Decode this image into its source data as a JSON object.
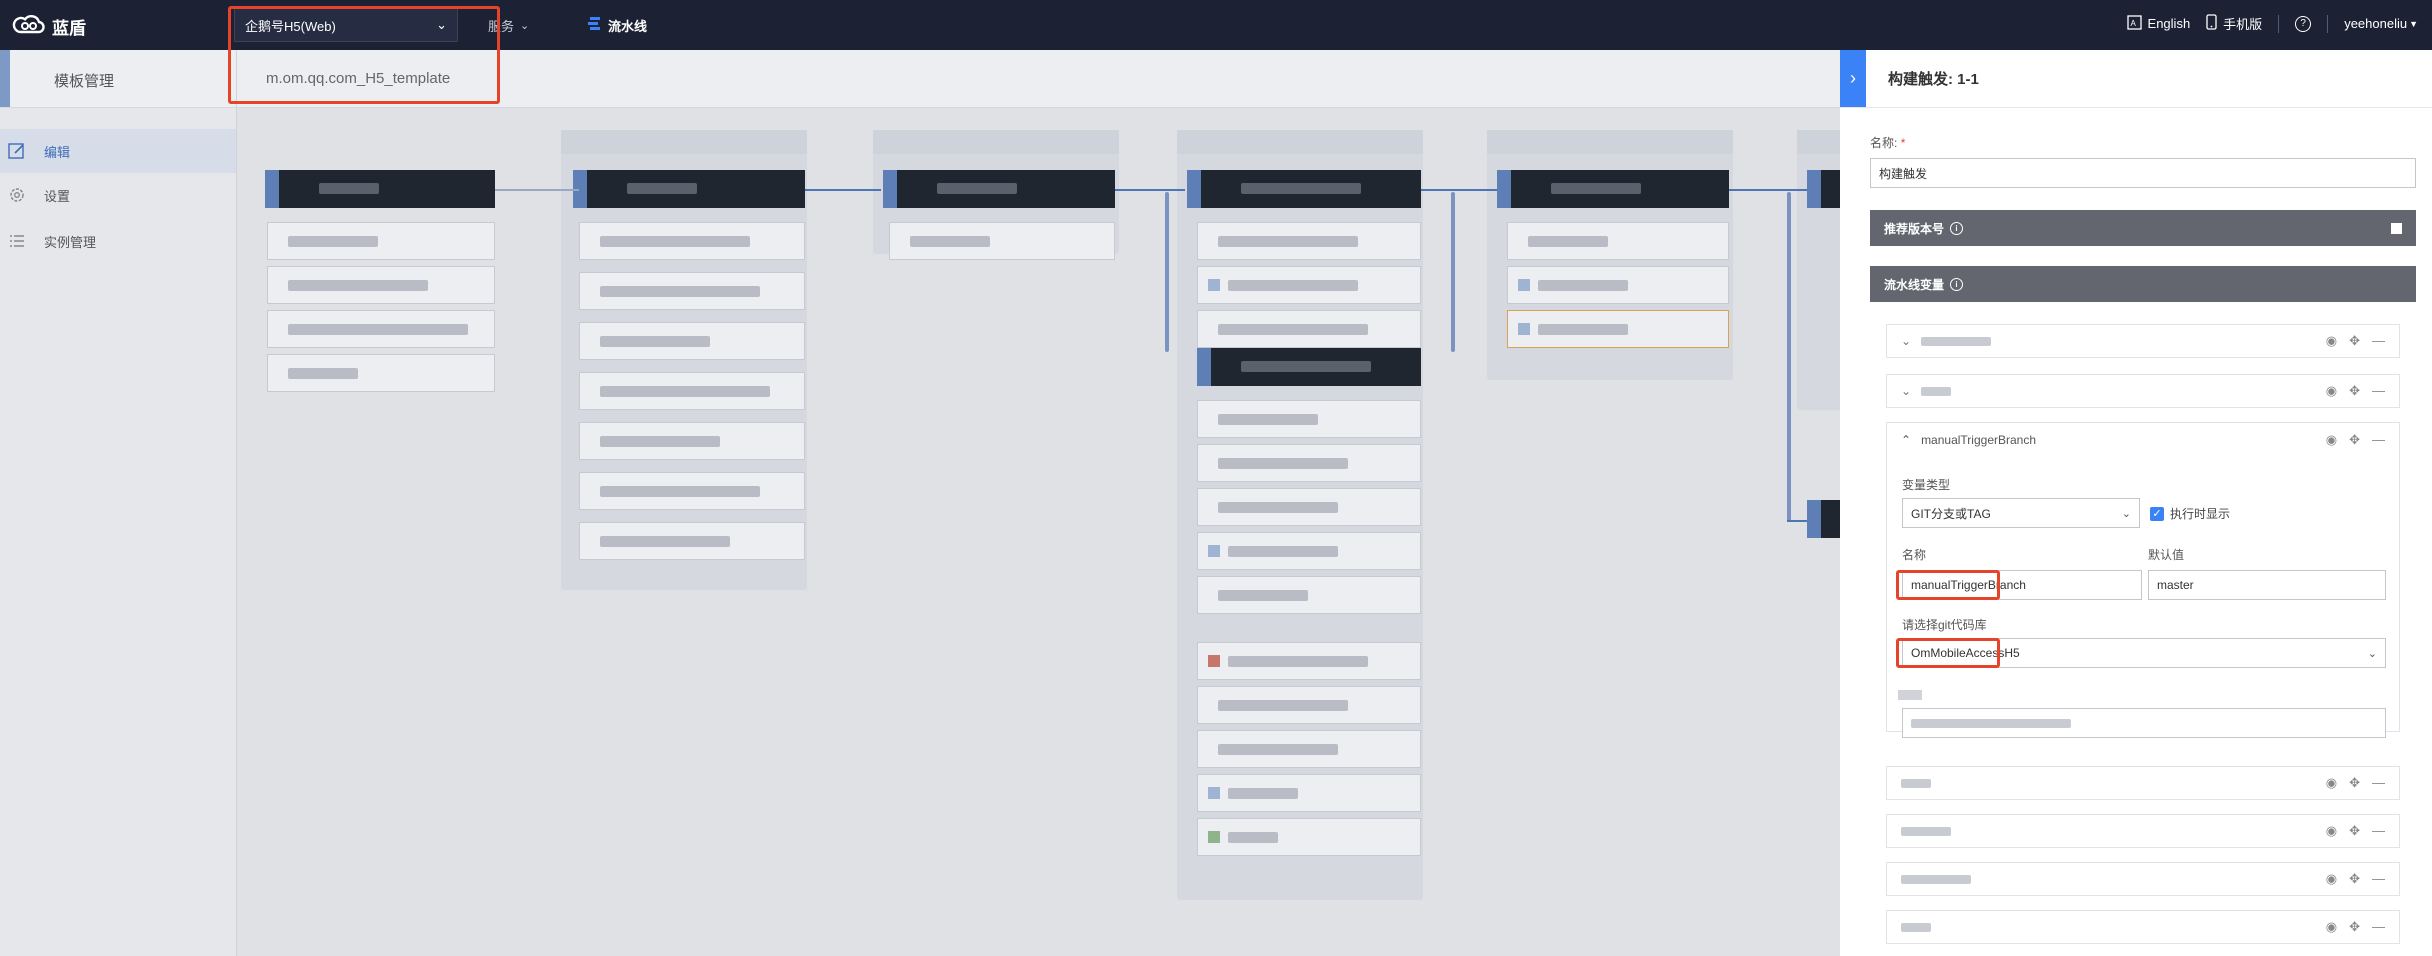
{
  "app": {
    "name": "蓝盾"
  },
  "topbar": {
    "project_select": "企鹅号H5(Web)",
    "nav": [
      {
        "label": "服务"
      },
      {
        "label": "流水线"
      }
    ],
    "right": {
      "language": "English",
      "mobile": "手机版",
      "help": "?",
      "user": "yeehoneliu"
    }
  },
  "subbar": {
    "section_title": "模板管理",
    "template_name": "m.om.qq.com_H5_template"
  },
  "sidebar": {
    "items": [
      {
        "label": "编辑"
      },
      {
        "label": "设置"
      },
      {
        "label": "实例管理"
      }
    ]
  },
  "panel": {
    "title": "构建触发:  1-1",
    "name_label": "名称:",
    "name_value": "构建触发",
    "recommend_version_label": "推荐版本号",
    "pipeline_vars_label": "流水线变量",
    "expanded_var": {
      "header": "manualTriggerBranch",
      "type_label": "变量类型",
      "type_value": "GIT分支或TAG",
      "show_on_run_label": "执行时显示",
      "name_label": "名称",
      "name_value": "manualTriggerBranch",
      "default_label": "默认值",
      "default_value": "master",
      "repo_label": "请选择git代码库",
      "repo_value": "OmMobileAccessH5"
    }
  },
  "colors": {
    "topbar": "#1c2233",
    "accent": "#3b82f6",
    "highlight": "#e5442b"
  }
}
